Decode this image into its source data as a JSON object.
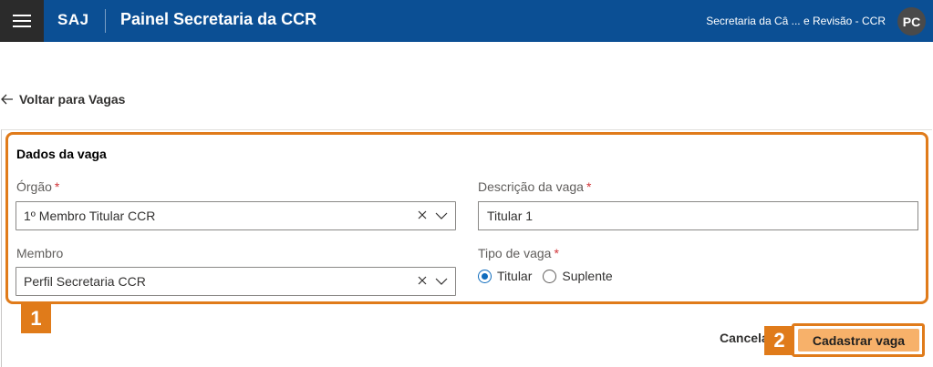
{
  "header": {
    "app_name": "SAJ",
    "panel_title": "Painel Secretaria da CCR",
    "user_label": "Secretaria da Câ ... e Revisão - CCR",
    "avatar_initials": "PC",
    "bar_color": "#0b4f94"
  },
  "nav": {
    "back_label": "Voltar para Vagas"
  },
  "form": {
    "section_title": "Dados da vaga",
    "orgao": {
      "label": "Órgão",
      "required_mark": "*",
      "value": "1º Membro Titular CCR"
    },
    "membro": {
      "label": "Membro",
      "value": "Perfil Secretaria CCR"
    },
    "descricao": {
      "label": "Descrição da vaga",
      "required_mark": "*",
      "value": "Titular 1"
    },
    "tipo": {
      "label": "Tipo de vaga",
      "required_mark": "*",
      "options": [
        {
          "label": "Titular",
          "selected": true
        },
        {
          "label": "Suplente",
          "selected": false
        }
      ]
    }
  },
  "actions": {
    "cancel_label": "Cancelar",
    "submit_label": "Cadastrar vaga"
  },
  "annotations": {
    "badge_1": "1",
    "badge_2": "2",
    "highlight_color": "#e07b1a"
  }
}
